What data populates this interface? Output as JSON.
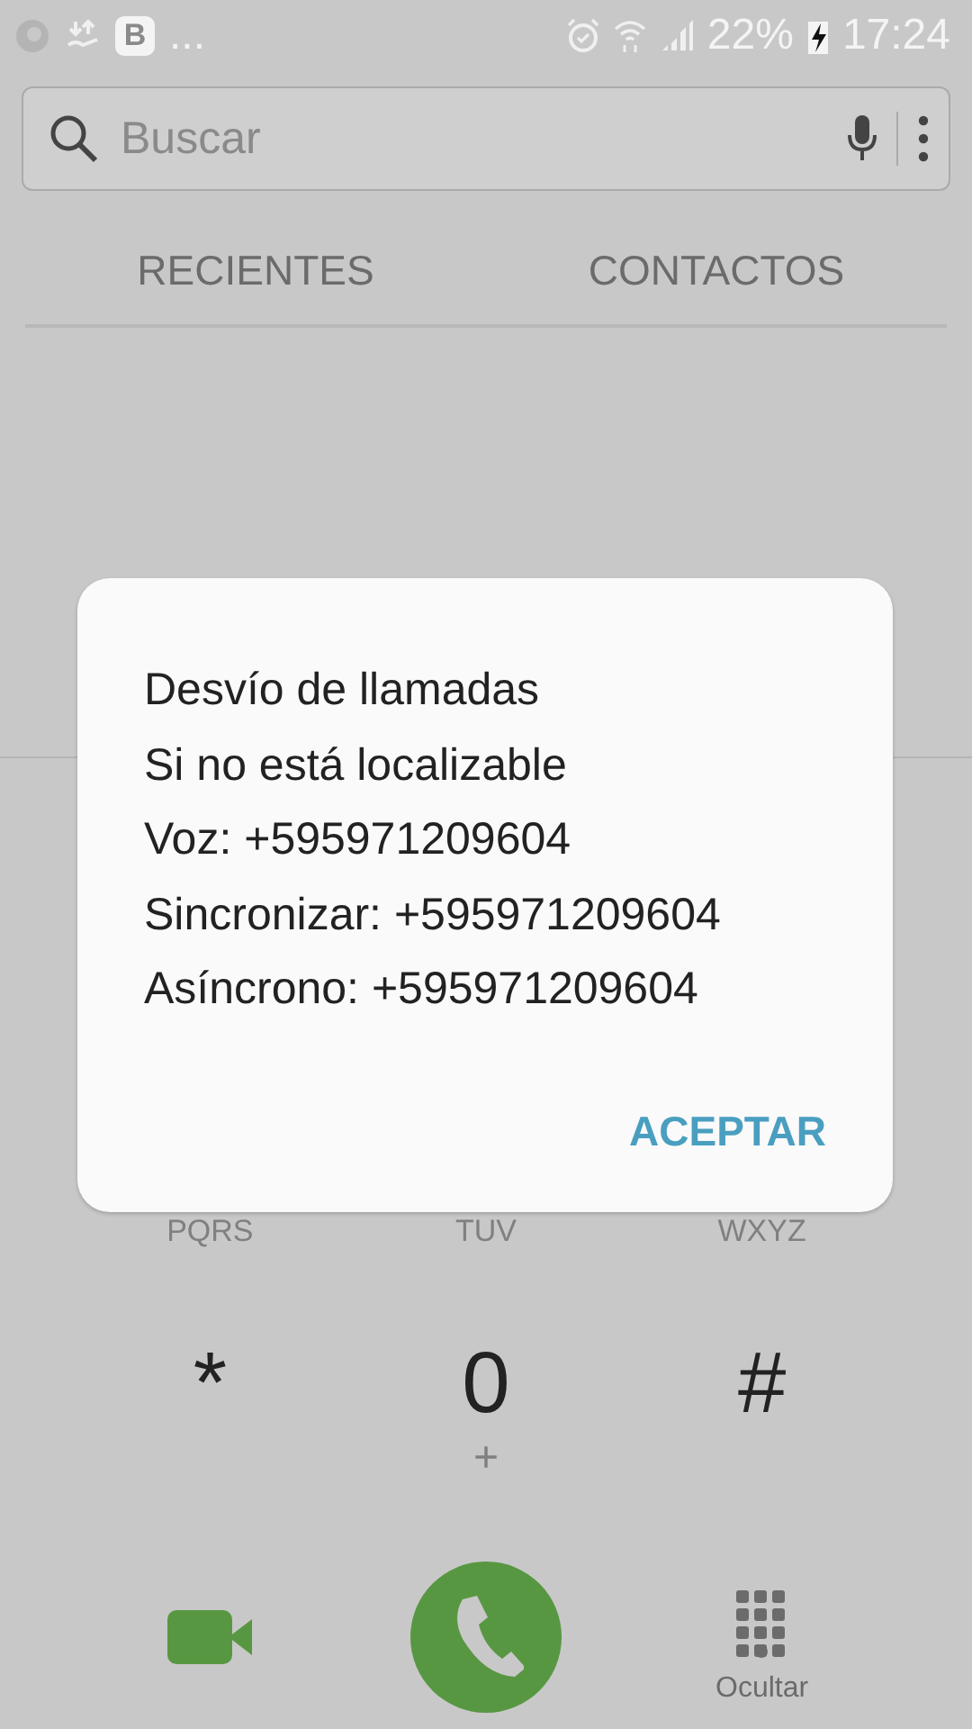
{
  "status_bar": {
    "app_badge": "B",
    "more": "...",
    "battery": "22%",
    "time": "17:24"
  },
  "search": {
    "placeholder": "Buscar"
  },
  "tabs": [
    {
      "label": "RECIENTES",
      "selected": false
    },
    {
      "label": "CONTACTOS",
      "selected": false
    }
  ],
  "keypad": [
    [
      {
        "letters": "PQRS"
      },
      {
        "letters": "TUV"
      },
      {
        "letters": "WXYZ"
      }
    ],
    [
      {
        "digit": "*"
      },
      {
        "digit": "0",
        "letters": "+"
      },
      {
        "digit": "#"
      }
    ]
  ],
  "bottom_bar": {
    "hide_label": "Ocultar"
  },
  "dialog": {
    "lines": [
      "Desvío de llamadas",
      "Si no está localizable",
      "Voz: +595971209604",
      "Sincronizar: +595971209604",
      "Asíncrono: +595971209604"
    ],
    "button": "ACEPTAR"
  }
}
